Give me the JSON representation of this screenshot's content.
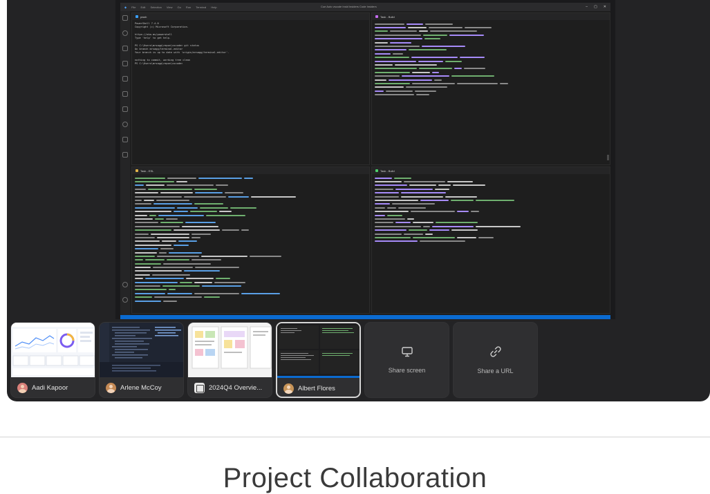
{
  "shared_screen": {
    "window": {
      "menu": [
        "File",
        "Edit",
        "Selection",
        "View",
        "Go",
        "Run",
        "Terminal",
        "Help"
      ],
      "title": "Cue  Auto  vscode  Insid Insiders Code  Insiders"
    },
    "panes": [
      {
        "tab": "pwsh"
      },
      {
        "tab": "Task - Build"
      },
      {
        "tab": "Task - ESL"
      },
      {
        "tab": "Task - Build"
      }
    ],
    "terminal_text": {
      "line1": "PowerShell 7.4.0",
      "line2": "Copyright (c) Microsoft Corporation.",
      "line3": "https://aka.ms/powershell",
      "line4": "Type 'help' to get help.",
      "line5": "PS C:\\Users\\mrsagg\\repos\\vscode> git status",
      "line6": "On branch mrsagg/terminal-editor",
      "line7": "Your branch is up to date with 'origin/mrsagg/terminal-editor'.",
      "line8": "nothing to commit, working tree clean",
      "line9": "PS C:\\Users\\mrsagg\\repos\\vscode>"
    }
  },
  "participants": [
    {
      "name": "Aadi Kapoor",
      "avatar_color": "#d9807a",
      "type": "person"
    },
    {
      "name": "Arlene McCoy",
      "avatar_color": "#c58a55",
      "type": "person"
    },
    {
      "name": "2024Q4 Overvie...",
      "type": "document"
    },
    {
      "name": "Albert Flores",
      "avatar_color": "#c79458",
      "type": "person",
      "active": true
    }
  ],
  "actions": [
    {
      "label": "Share screen",
      "icon": "monitor-icon"
    },
    {
      "label": "Share a URL",
      "icon": "link-icon"
    }
  ],
  "section_title": "Project Collaboration",
  "colors": {
    "panel_bg": "#232325",
    "statusbar": "#0b6bd1",
    "tile_bg": "#2f2f31"
  }
}
